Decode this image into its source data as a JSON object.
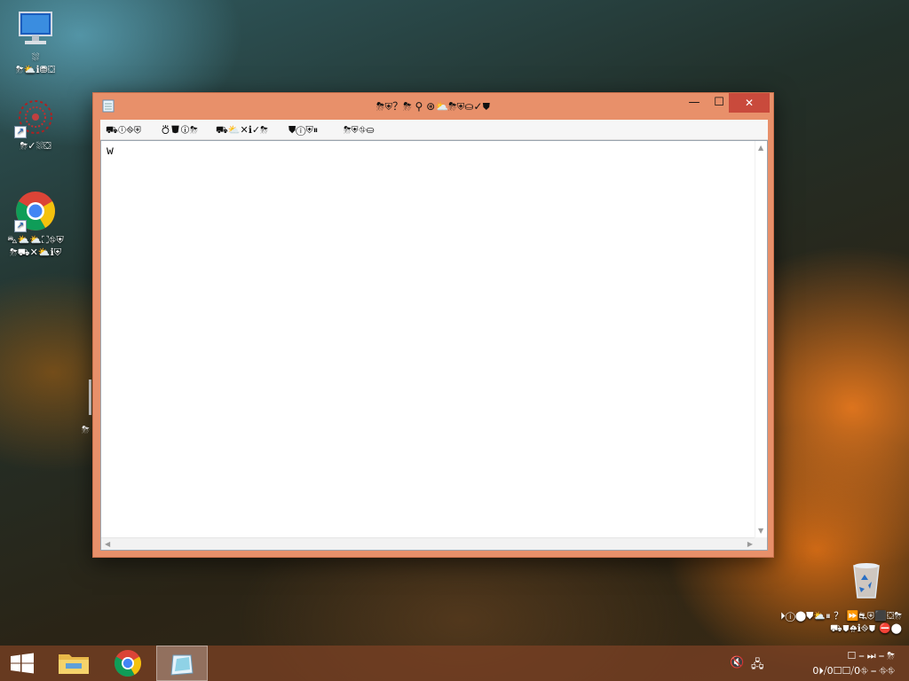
{
  "desktop": {
    "icons": [
      {
        "name": "this-pc",
        "label_line1": "⛆",
        "label_line2": "⛈⛅ℹ⛃⛋"
      },
      {
        "name": "app-shortcut",
        "label_line1": "",
        "label_line2": "⛈✓⛆⛋"
      },
      {
        "name": "google-chrome",
        "label_line1": "⛍⛅⛅⛶⛗⛨",
        "label_line2": "⛈⛟✕⛅ℹ⛨"
      },
      {
        "name": "recycle-bin",
        "label_line1": "",
        "label_line2": ""
      }
    ],
    "system_lines": [
      "⏵ⓘ⬤⛊⛅⏸ ？ ⏩⛐⛨⬛⛋⛈",
      "⛟⛊⛈ℹ⛗⛊ ⛔⬤",
      "⛐⛊⛉ ⛔⛋ ⛈ ⛋"
    ]
  },
  "window": {
    "title": "⛈⛨？⛈ ⚲ ⊛⛅⛈⛨⛀✓⛊",
    "minimize": "—",
    "maximize": "☐",
    "close": "✕",
    "menu": [
      "⛟ⓘ⛗⛨",
      "⛣⛊ⓘ⛈",
      "⛟⛅✕ℹ✓⛈",
      "⛊ⓘ⛨⏸",
      "⛈⛨⛗⛀"
    ],
    "content": "w"
  },
  "taskbar": {
    "items": [
      "start",
      "file-explorer",
      "chrome",
      "notepad"
    ],
    "tray_time": "☐ ⎯ ⏭ ⎯ ⛈",
    "tray_date": "0⏵⧸0☐☐⧸0⛗ ⎯ ⛗⛗"
  },
  "colors": {
    "window_frame": "#e8906a",
    "close_button": "#c94a3c",
    "taskbar": "#784024"
  }
}
